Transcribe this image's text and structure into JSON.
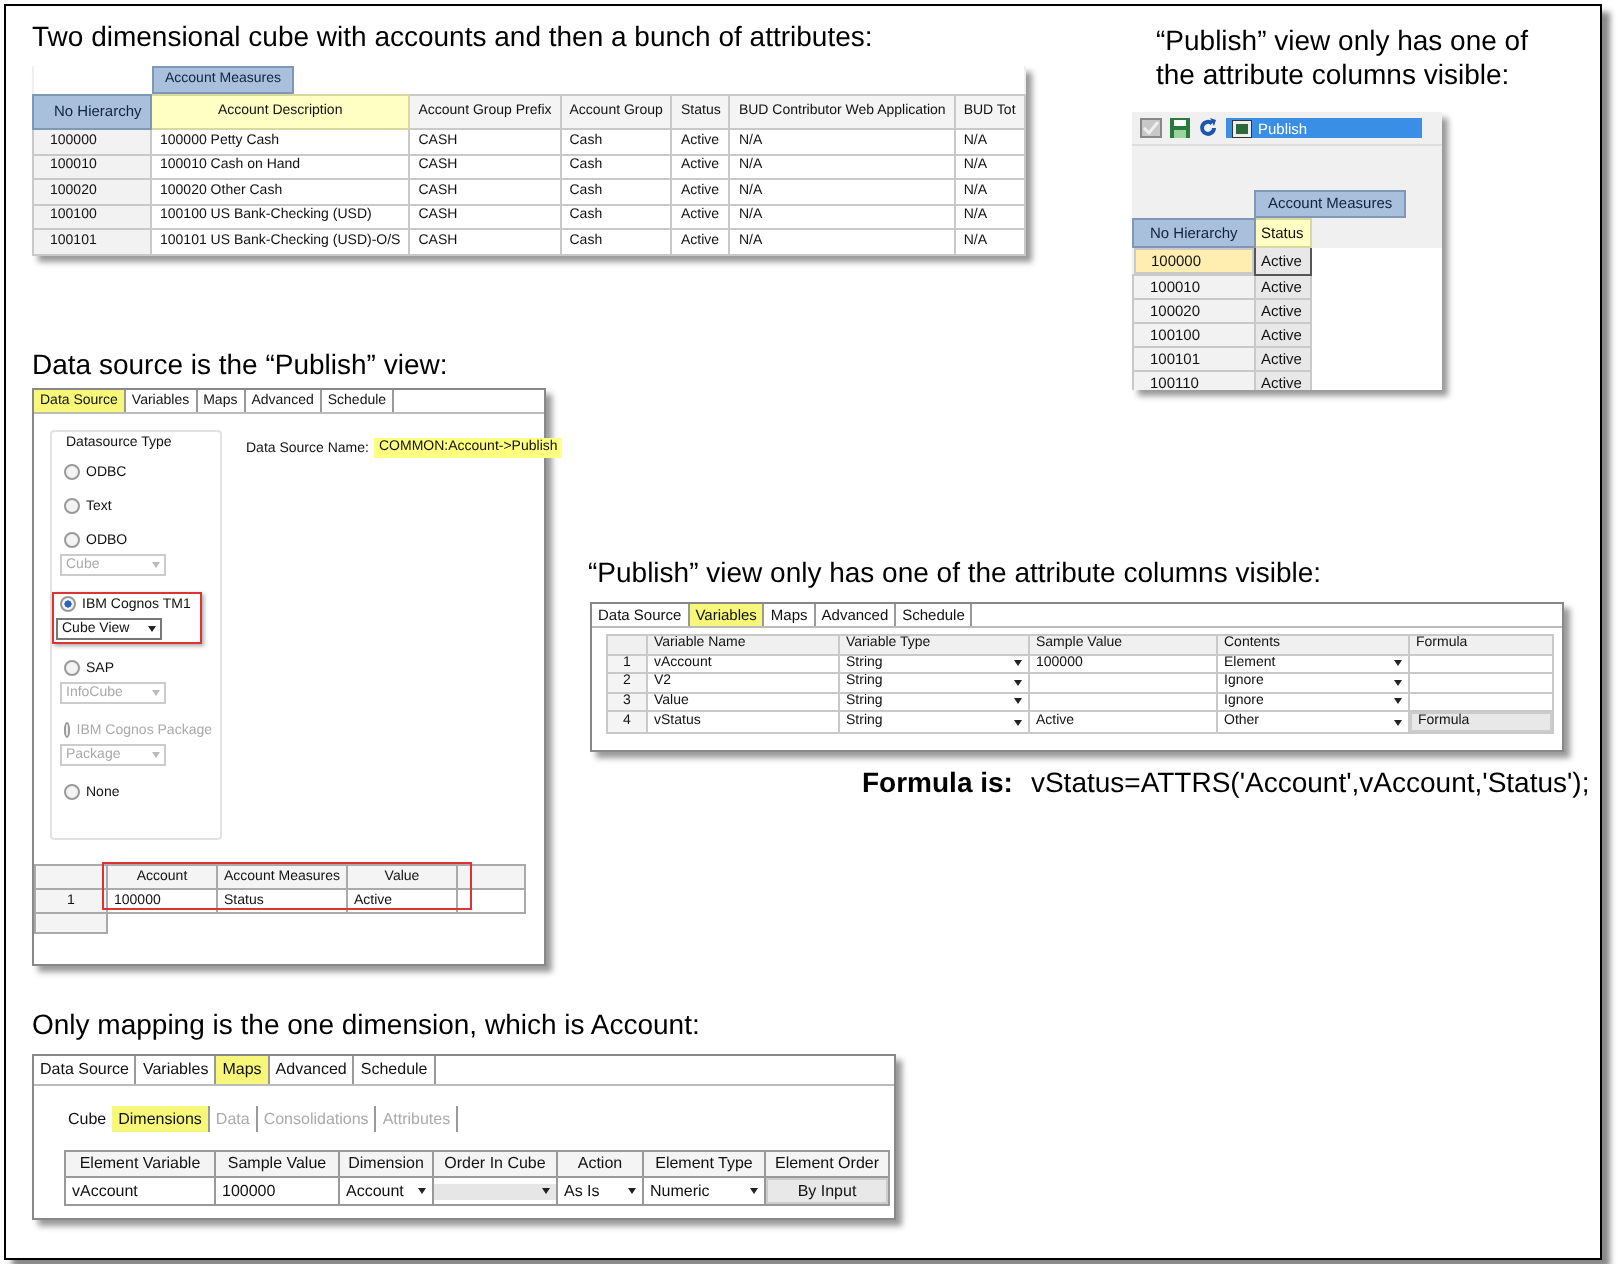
{
  "cube_view": {
    "caption": "Two dimensional cube with accounts and then a bunch of attributes:",
    "measures_label": "Account Measures",
    "hierarchy_label": "No Hierarchy",
    "columns": [
      {
        "label": "Account Description",
        "selected": true
      },
      {
        "label": "Account Group Prefix",
        "selected": false
      },
      {
        "label": "Account Group",
        "selected": false
      },
      {
        "label": "Status",
        "selected": false
      },
      {
        "label": "BUD Contributor Web Application",
        "selected": false
      },
      {
        "label": "BUD Tot",
        "selected": false
      }
    ],
    "rows": [
      {
        "id": "100000",
        "cells": [
          "100000 Petty Cash",
          "CASH",
          "Cash",
          "Active",
          "N/A",
          "N/A"
        ]
      },
      {
        "id": "100010",
        "cells": [
          "100010 Cash on Hand",
          "CASH",
          "Cash",
          "Active",
          "N/A",
          "N/A"
        ]
      },
      {
        "id": "100020",
        "cells": [
          "100020 Other Cash",
          "CASH",
          "Cash",
          "Active",
          "N/A",
          "N/A"
        ]
      },
      {
        "id": "100100",
        "cells": [
          "100100 US Bank-Checking (USD)",
          "CASH",
          "Cash",
          "Active",
          "N/A",
          "N/A"
        ]
      },
      {
        "id": "100101",
        "cells": [
          "100101 US Bank-Checking (USD)-O/S",
          "CASH",
          "Cash",
          "Active",
          "N/A",
          "N/A"
        ]
      }
    ]
  },
  "publish_view": {
    "caption": "“Publish” view only has one of the attribute columns visible:",
    "view_name": "Publish",
    "measures_label": "Account Measures",
    "hierarchy_label": "No Hierarchy",
    "column": "Status",
    "rows": [
      {
        "id": "100000",
        "value": "Active",
        "selected": true
      },
      {
        "id": "100010",
        "value": "Active",
        "selected": false
      },
      {
        "id": "100020",
        "value": "Active",
        "selected": false
      },
      {
        "id": "100100",
        "value": "Active",
        "selected": false
      },
      {
        "id": "100101",
        "value": "Active",
        "selected": false
      },
      {
        "id": "100110",
        "value": "Active",
        "selected": false
      }
    ]
  },
  "data_source": {
    "caption": "Data source is the “Publish” view:",
    "tabs": [
      {
        "label": "Data Source",
        "selected": true
      },
      {
        "label": "Variables",
        "selected": false
      },
      {
        "label": "Maps",
        "selected": false
      },
      {
        "label": "Advanced",
        "selected": false
      },
      {
        "label": "Schedule",
        "selected": false
      }
    ],
    "group_label": "Datasource Type",
    "name_label": "Data Source Name:",
    "name_value": "COMMON:Account->Publish",
    "options": [
      {
        "label": "ODBC",
        "selected": false,
        "disabled": false,
        "highlighted": false
      },
      {
        "label": "Text",
        "selected": false,
        "disabled": false,
        "highlighted": false
      },
      {
        "label": "ODBO",
        "selected": false,
        "disabled": false,
        "highlighted": false,
        "select": {
          "value": "Cube",
          "disabled": true
        }
      },
      {
        "label": "IBM Cognos TM1",
        "selected": true,
        "disabled": false,
        "highlighted": true,
        "select": {
          "value": "Cube View",
          "disabled": false
        }
      },
      {
        "label": "SAP",
        "selected": false,
        "disabled": false,
        "highlighted": false,
        "select": {
          "value": "InfoCube",
          "disabled": true
        }
      },
      {
        "label": "IBM Cognos Package",
        "selected": false,
        "disabled": true,
        "highlighted": false,
        "select": {
          "value": "Package",
          "disabled": true
        }
      },
      {
        "label": "None",
        "selected": false,
        "disabled": false,
        "highlighted": false
      }
    ],
    "preview": {
      "columns": [
        "Account",
        "Account Measures",
        "Value"
      ],
      "rows": [
        {
          "num": "1",
          "cells": [
            "100000",
            "Status",
            "Active"
          ]
        }
      ]
    }
  },
  "variables": {
    "caption": "“Publish” view only has one of the attribute columns visible:",
    "tabs": [
      {
        "label": "Data Source",
        "selected": false
      },
      {
        "label": "Variables",
        "selected": true
      },
      {
        "label": "Maps",
        "selected": false
      },
      {
        "label": "Advanced",
        "selected": false
      },
      {
        "label": "Schedule",
        "selected": false
      }
    ],
    "columns": [
      {
        "label": "Variable Name",
        "kind": "text"
      },
      {
        "label": "Variable Type",
        "kind": "dropdown"
      },
      {
        "label": "Sample Value",
        "kind": "text"
      },
      {
        "label": "Contents",
        "kind": "dropdown"
      },
      {
        "label": "Formula",
        "kind": "button"
      }
    ],
    "rows": [
      {
        "num": "1",
        "cells": [
          "vAccount",
          "String",
          "100000",
          "Element",
          null
        ]
      },
      {
        "num": "2",
        "cells": [
          "V2",
          "String",
          null,
          "Ignore",
          null
        ]
      },
      {
        "num": "3",
        "cells": [
          "Value",
          "String",
          null,
          "Ignore",
          null
        ]
      },
      {
        "num": "4",
        "cells": [
          "vStatus",
          "String",
          "Active",
          "Other",
          "Formula"
        ]
      }
    ],
    "formula_label": "Formula is:",
    "formula": "vStatus=ATTRS('Account',vAccount,'Status');"
  },
  "maps": {
    "caption": "Only mapping is the one dimension, which is Account:",
    "tabs": [
      {
        "label": "Data Source",
        "selected": false
      },
      {
        "label": "Variables",
        "selected": false
      },
      {
        "label": "Maps",
        "selected": true
      },
      {
        "label": "Advanced",
        "selected": false
      },
      {
        "label": "Schedule",
        "selected": false
      }
    ],
    "subtabs": [
      {
        "label": "Cube",
        "selected": false,
        "disabled": false
      },
      {
        "label": "Dimensions",
        "selected": true,
        "disabled": false
      },
      {
        "label": "Data",
        "selected": false,
        "disabled": true
      },
      {
        "label": "Consolidations",
        "selected": false,
        "disabled": true
      },
      {
        "label": "Attributes",
        "selected": false,
        "disabled": true
      }
    ],
    "columns": [
      {
        "label": "Element Variable",
        "kind": "text"
      },
      {
        "label": "Sample Value",
        "kind": "text"
      },
      {
        "label": "Dimension",
        "kind": "dropdown"
      },
      {
        "label": "Order In Cube",
        "kind": "dropdown"
      },
      {
        "label": "Action",
        "kind": "dropdown"
      },
      {
        "label": "Element Type",
        "kind": "dropdown"
      },
      {
        "label": "Element Order",
        "kind": "button"
      }
    ],
    "rows": [
      {
        "cells": [
          "vAccount",
          "100000",
          "Account",
          null,
          "As Is",
          "Numeric",
          "By Input"
        ]
      }
    ]
  }
}
